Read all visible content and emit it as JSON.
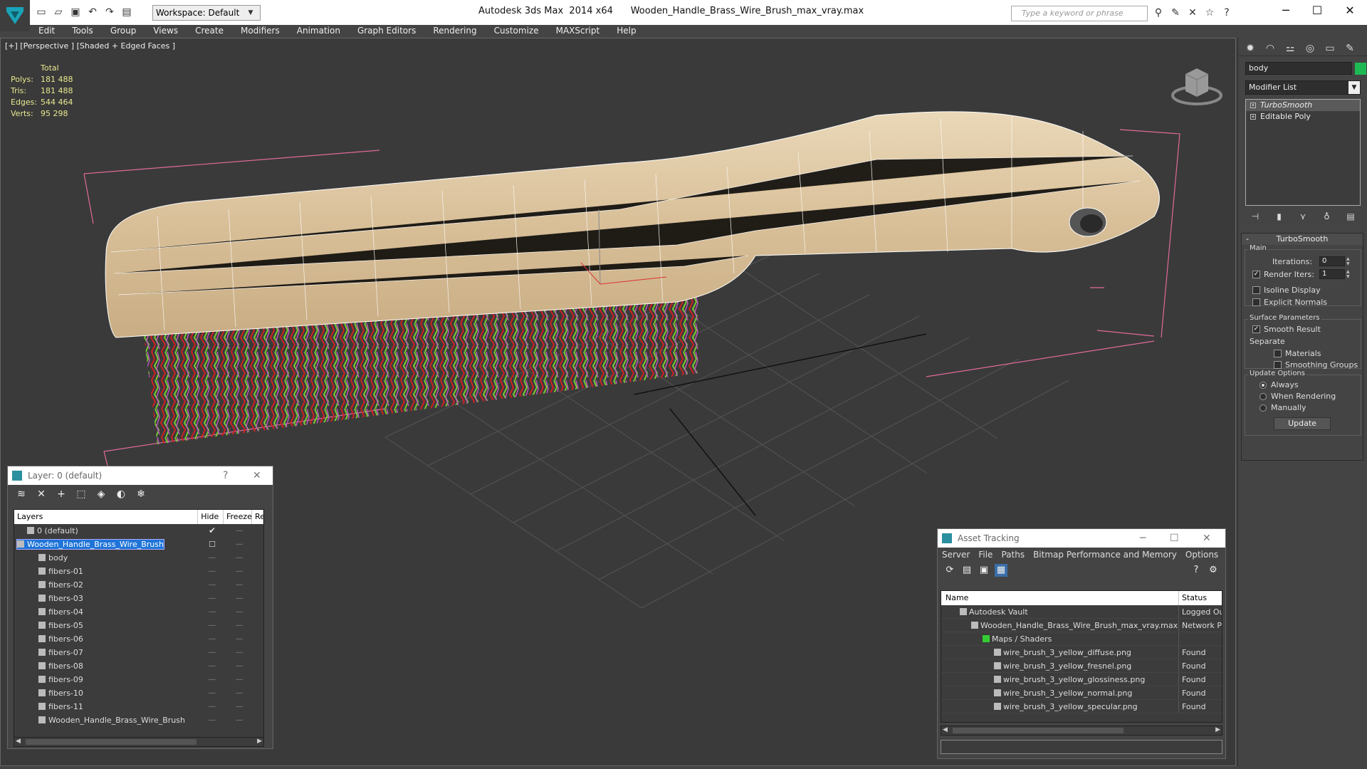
{
  "title": {
    "app": "Autodesk 3ds Max  2014 x64",
    "file": "Wooden_Handle_Brass_Wire_Brush_max_vray.max",
    "workspace": "Workspace: Default",
    "search_placeholder": "Type a keyword or phrase"
  },
  "menu": [
    "Edit",
    "Tools",
    "Group",
    "Views",
    "Create",
    "Modifiers",
    "Animation",
    "Graph Editors",
    "Rendering",
    "Customize",
    "MAXScript",
    "Help"
  ],
  "viewport": {
    "label": "[+] [Perspective ] [Shaded + Edged Faces ]",
    "stats_header": "Total",
    "stats": [
      {
        "k": "Polys:",
        "v": "181 488"
      },
      {
        "k": "Tris:",
        "v": "181 488"
      },
      {
        "k": "Edges:",
        "v": "544 464"
      },
      {
        "k": "Verts:",
        "v": "95 298"
      }
    ]
  },
  "command_panel": {
    "object_name": "body",
    "object_color": "#1db954",
    "modifier_list": "Modifier List",
    "stack": [
      "TurboSmooth",
      "Editable Poly"
    ],
    "rollout_title": "TurboSmooth",
    "main_label": "Main",
    "iterations_label": "Iterations:",
    "iterations": "0",
    "render_iters_label": "Render Iters:",
    "render_iters": "1",
    "isoline": "Isoline Display",
    "explicit_normals": "Explicit Normals",
    "surface_params": "Surface Parameters",
    "smooth_result": "Smooth Result",
    "separate": "Separate",
    "materials": "Materials",
    "smoothing_groups": "Smoothing Groups",
    "update_options": "Update Options",
    "always": "Always",
    "when_rendering": "When Rendering",
    "manually": "Manually",
    "update_button": "Update"
  },
  "layer_panel": {
    "title": "Layer: 0 (default)",
    "help": "?",
    "cols": [
      "Layers",
      "Hide",
      "Freeze",
      "Re"
    ],
    "rows": [
      {
        "name": "0 (default)",
        "indent": 1
      },
      {
        "name": "Wooden_Handle_Brass_Wire_Brush",
        "indent": 1
      },
      {
        "name": "body",
        "indent": 2
      },
      {
        "name": "fibers-01",
        "indent": 2
      },
      {
        "name": "fibers-02",
        "indent": 2
      },
      {
        "name": "fibers-03",
        "indent": 2
      },
      {
        "name": "fibers-04",
        "indent": 2
      },
      {
        "name": "fibers-05",
        "indent": 2
      },
      {
        "name": "fibers-06",
        "indent": 2
      },
      {
        "name": "fibers-07",
        "indent": 2
      },
      {
        "name": "fibers-08",
        "indent": 2
      },
      {
        "name": "fibers-09",
        "indent": 2
      },
      {
        "name": "fibers-10",
        "indent": 2
      },
      {
        "name": "fibers-11",
        "indent": 2
      },
      {
        "name": "Wooden_Handle_Brass_Wire_Brush",
        "indent": 2
      }
    ]
  },
  "asset_panel": {
    "title": "Asset Tracking",
    "menu": [
      "Server",
      "File",
      "Paths",
      "Bitmap Performance and Memory",
      "Options"
    ],
    "cols": [
      "Name",
      "Status"
    ],
    "rows": [
      {
        "name": "Autodesk Vault",
        "status": "Logged Ou"
      },
      {
        "name": "Wooden_Handle_Brass_Wire_Brush_max_vray.max",
        "status": "Network P"
      },
      {
        "name": "Maps / Shaders",
        "status": ""
      },
      {
        "name": "wire_brush_3_yellow_diffuse.png",
        "status": "Found"
      },
      {
        "name": "wire_brush_3_yellow_fresnel.png",
        "status": "Found"
      },
      {
        "name": "wire_brush_3_yellow_glossiness.png",
        "status": "Found"
      },
      {
        "name": "wire_brush_3_yellow_normal.png",
        "status": "Found"
      },
      {
        "name": "wire_brush_3_yellow_specular.png",
        "status": "Found"
      }
    ]
  }
}
